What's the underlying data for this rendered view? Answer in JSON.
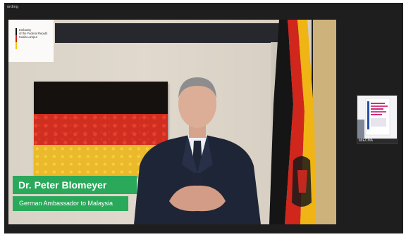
{
  "window": {
    "recording_label": "ording"
  },
  "logo": {
    "lines": [
      "Embassy",
      "of the Federal Republ",
      "Kuala Lumpur"
    ],
    "flag_colors": [
      "#111111",
      "#d2231c",
      "#f5c400"
    ]
  },
  "lower_third": {
    "name": "Dr. Peter Blomeyer",
    "title": "German Ambassador to Malaysia",
    "color": "#2aa95a"
  },
  "thumbnail": {
    "label": "MIECMA"
  },
  "colors": {
    "flag_black": "#151515",
    "flag_red": "#d0261c",
    "flag_gold": "#f0b414",
    "suit": "#1e2536"
  }
}
